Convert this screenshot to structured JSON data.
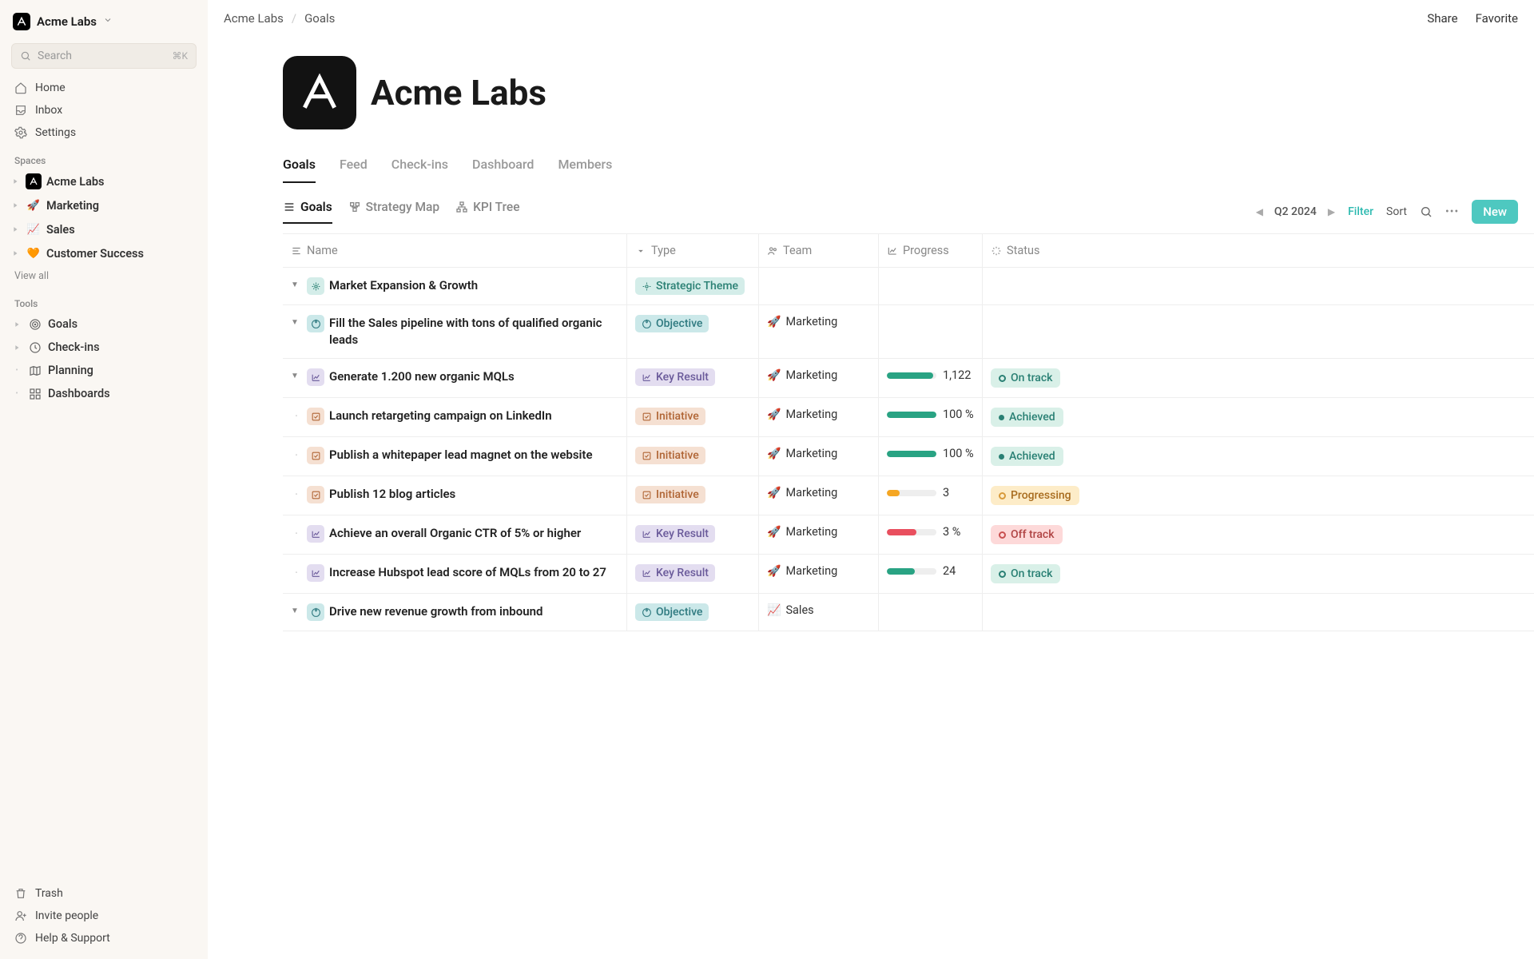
{
  "workspace": {
    "name": "Acme Labs"
  },
  "search": {
    "placeholder": "Search",
    "shortcut": "⌘K"
  },
  "nav": {
    "home": "Home",
    "inbox": "Inbox",
    "settings": "Settings"
  },
  "sections": {
    "spaces": "Spaces",
    "tools": "Tools"
  },
  "spaces": [
    {
      "label": "Acme Labs",
      "emoji_type": "logo"
    },
    {
      "label": "Marketing",
      "emoji": "🚀"
    },
    {
      "label": "Sales",
      "emoji": "📈"
    },
    {
      "label": "Customer Success",
      "emoji": "🧡"
    }
  ],
  "view_all": "View all",
  "tools": [
    {
      "label": "Goals",
      "caret": true
    },
    {
      "label": "Check-ins",
      "caret": true
    },
    {
      "label": "Planning",
      "caret": false
    },
    {
      "label": "Dashboards",
      "caret": false
    }
  ],
  "footer": {
    "trash": "Trash",
    "invite": "Invite people",
    "help": "Help & Support"
  },
  "breadcrumb": {
    "root": "Acme Labs",
    "current": "Goals",
    "sep": "/"
  },
  "topbar": {
    "share": "Share",
    "favorite": "Favorite"
  },
  "page": {
    "title": "Acme Labs"
  },
  "tabs": [
    "Goals",
    "Feed",
    "Check-ins",
    "Dashboard",
    "Members"
  ],
  "views": [
    "Goals",
    "Strategy Map",
    "KPI Tree"
  ],
  "period": {
    "label": "Q2 2024"
  },
  "toolbar": {
    "filter": "Filter",
    "sort": "Sort",
    "new": "New"
  },
  "columns": {
    "name": "Name",
    "type": "Type",
    "team": "Team",
    "progress": "Progress",
    "status": "Status"
  },
  "statuses": {
    "on_track": "On track",
    "achieved": "Achieved",
    "progressing": "Progressing",
    "off_track": "Off track"
  },
  "types": {
    "strategic_theme": "Strategic Theme",
    "objective": "Objective",
    "key_result": "Key Result",
    "initiative": "Initiative"
  },
  "teams": {
    "marketing": "Marketing",
    "sales": "Sales"
  },
  "rows": [
    {
      "name": "Market Expansion & Growth"
    },
    {
      "name": "Fill the Sales pipeline with tons of qualified organic leads"
    },
    {
      "name": "Generate 1.200 new organic MQLs",
      "progress": "1,122"
    },
    {
      "name": "Launch retargeting campaign on LinkedIn",
      "progress": "100 %"
    },
    {
      "name": "Publish a whitepaper lead magnet on the website",
      "progress": "100 %"
    },
    {
      "name": "Publish 12 blog articles",
      "progress": "3"
    },
    {
      "name": "Achieve an overall Organic CTR of 5% or higher",
      "progress": "3 %"
    },
    {
      "name": "Increase Hubspot lead score of MQLs from 20 to 27",
      "progress": "24"
    },
    {
      "name": "Drive new revenue growth from inbound"
    }
  ]
}
